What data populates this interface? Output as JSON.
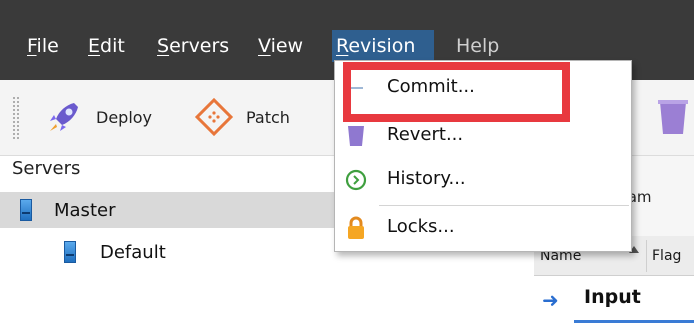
{
  "menubar": {
    "items": [
      {
        "mnemonic": "F",
        "rest": "ile"
      },
      {
        "mnemonic": "E",
        "rest": "dit"
      },
      {
        "mnemonic": "S",
        "rest": "ervers"
      },
      {
        "mnemonic": "V",
        "rest": "iew"
      },
      {
        "mnemonic": "R",
        "rest": "evision"
      },
      {
        "label": "Help"
      }
    ]
  },
  "toolbar": {
    "deploy_label": "Deploy",
    "patch_label": "Patch"
  },
  "tree": {
    "header": "Servers",
    "master_label": "Master",
    "default_label": "Default"
  },
  "revision_menu": {
    "items": [
      {
        "label": "Commit...",
        "icon": "commit-icon"
      },
      {
        "label": "Revert...",
        "icon": "revert-icon"
      },
      {
        "label": "History...",
        "icon": "history-icon"
      },
      {
        "label": "Locks...",
        "icon": "lock-icon"
      }
    ]
  },
  "right_panel": {
    "partial_label": "gram",
    "columns": [
      "Name",
      "Flag"
    ],
    "row_label": "Input"
  },
  "colors": {
    "highlight": "#e8393f",
    "menubar_bg": "#3a3a3a",
    "active_menu_bg": "#2f5f8f"
  }
}
